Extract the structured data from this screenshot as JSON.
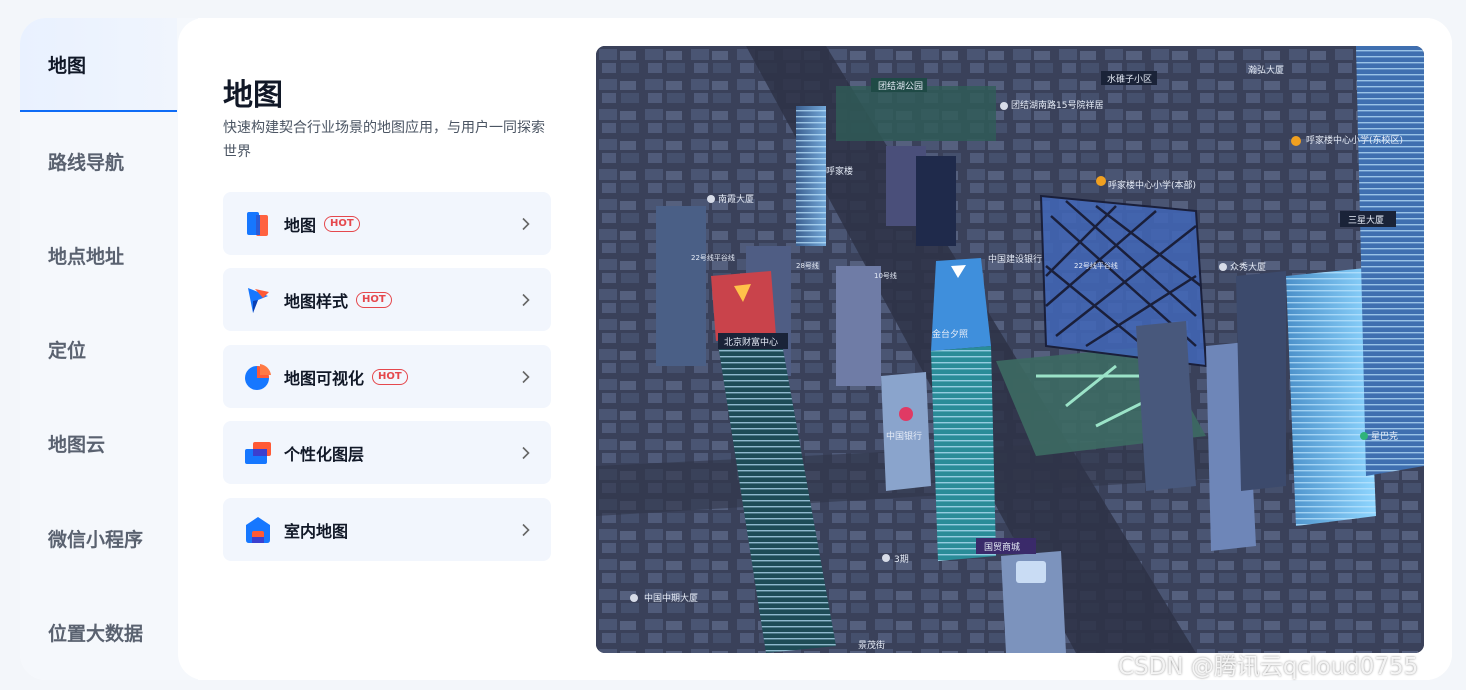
{
  "sidebar": {
    "items": [
      {
        "label": "地图",
        "active": true
      },
      {
        "label": "路线导航"
      },
      {
        "label": "地点地址"
      },
      {
        "label": "定位"
      },
      {
        "label": "地图云"
      },
      {
        "label": "微信小程序"
      },
      {
        "label": "位置大数据"
      }
    ]
  },
  "main": {
    "title": "地图",
    "description": "快速构建契合行业场景的地图应用，与用户一同探索世界",
    "products": [
      {
        "label": "地图",
        "badge": "HOT",
        "icon": "map-book-icon"
      },
      {
        "label": "地图样式",
        "badge": "HOT",
        "icon": "map-style-icon"
      },
      {
        "label": "地图可视化",
        "badge": "HOT",
        "icon": "map-visualization-icon"
      },
      {
        "label": "个性化图层",
        "badge": "",
        "icon": "custom-layer-icon"
      },
      {
        "label": "室内地图",
        "badge": "",
        "icon": "indoor-map-icon"
      }
    ]
  },
  "map": {
    "labels": {
      "l1": "团结湖公园",
      "l2": "水碓子小区",
      "l3": "团结湖南路15号院祥居",
      "l4": "呼家楼中心小学(东校区)",
      "l5": "呼家楼",
      "l6": "呼家楼中心小学(本部)",
      "l7": "南霞大厦",
      "l8": "三星大厦",
      "l9": "中国建设银行",
      "l10": "众秀大厦",
      "l11": "北京财富中心",
      "l12": "金台夕照",
      "l13": "中国银行",
      "l14": "星巴克",
      "l15": "国贸商城",
      "l16": "中国中期大厦",
      "l17": "景茂街",
      "l18": "3期",
      "l19": "10号线",
      "l20": "28号线",
      "l21": "22号线平谷线",
      "l22": "22号线平谷线",
      "l23": "瀚弘大厦"
    }
  },
  "watermark": "CSDN @腾讯云qcloud0755",
  "colors": {
    "accent": "#0e6cf6",
    "hot": "#e5484d",
    "map_bg": "#2b3046"
  }
}
